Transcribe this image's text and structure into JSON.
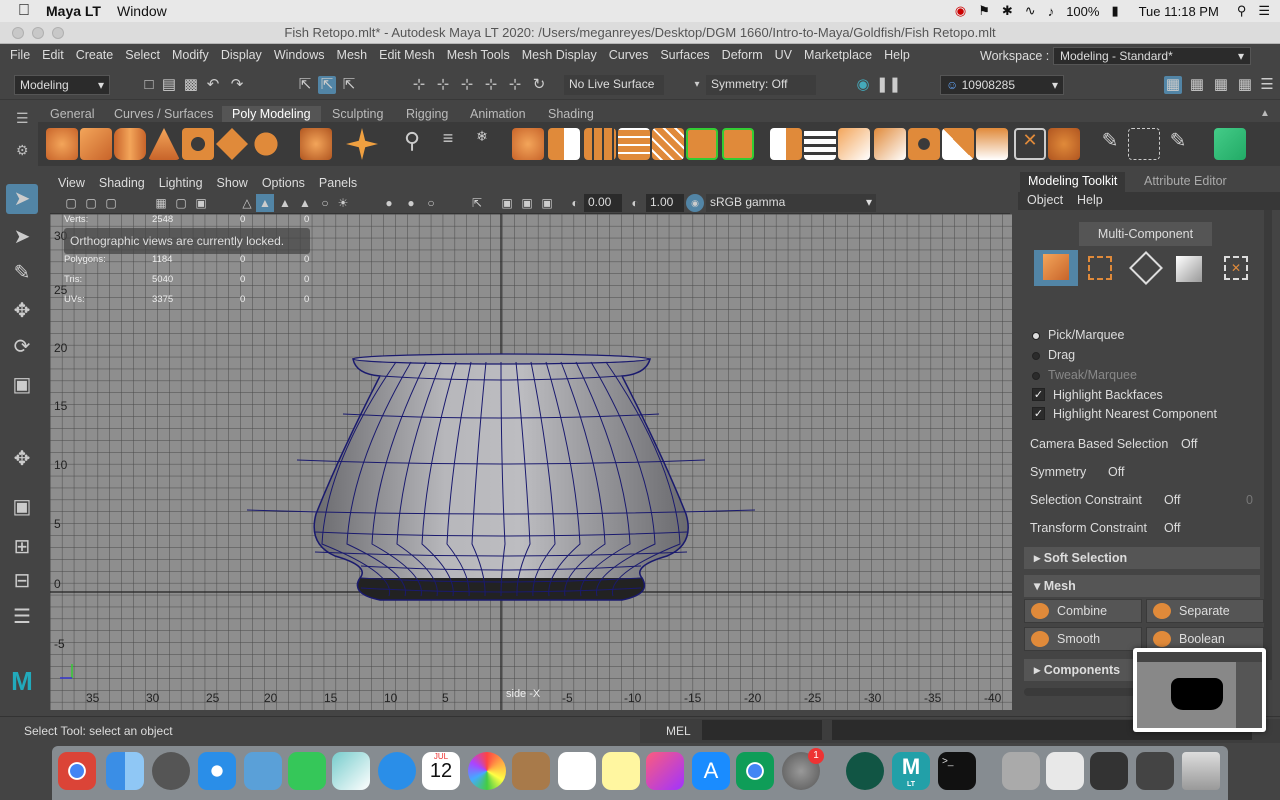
{
  "mac_menubar": {
    "app_name": "Maya LT",
    "menu_window": "Window",
    "battery": "100%",
    "clock": "Tue 11:18 PM"
  },
  "window": {
    "title": "Fish Retopo.mlt* - Autodesk Maya LT 2020: /Users/meganreyes/Desktop/DGM 1660/Intro-to-Maya/Goldfish/Fish Retopo.mlt"
  },
  "maya_menu": {
    "items": [
      "File",
      "Edit",
      "Create",
      "Select",
      "Modify",
      "Display",
      "Windows",
      "Mesh",
      "Edit Mesh",
      "Mesh Tools",
      "Mesh Display",
      "Curves",
      "Surfaces",
      "Deform",
      "UV",
      "Marketplace",
      "Help"
    ],
    "workspace_label": "Workspace :",
    "workspace_value": "Modeling - Standard*"
  },
  "status_line": {
    "menuset": "Modeling",
    "live_surface": "No Live Surface",
    "symmetry": "Symmetry: Off",
    "user_id": "10908285"
  },
  "shelf": {
    "tabs": [
      "General",
      "Curves / Surfaces",
      "Poly Modeling",
      "Sculpting",
      "Rigging",
      "Animation",
      "Shading"
    ],
    "active_tab": "Poly Modeling"
  },
  "viewport": {
    "menu": [
      "View",
      "Shading",
      "Lighting",
      "Show",
      "Options",
      "Panels"
    ],
    "exposure": "0.00",
    "gamma": "1.00",
    "colorspace": "sRGB gamma",
    "hud": {
      "rows": [
        {
          "label": "Verts:",
          "a": "2548",
          "b": "0",
          "c": "0"
        },
        {
          "label": "Polygons:",
          "a": "1184",
          "b": "0",
          "c": "0"
        },
        {
          "label": "Tris:",
          "a": "5040",
          "b": "0",
          "c": "0"
        },
        {
          "label": "UVs:",
          "a": "3375",
          "b": "0",
          "c": "0"
        }
      ]
    },
    "locked_msg": "Orthographic views are currently locked.",
    "y_ticks": [
      "30",
      "25",
      "20",
      "15",
      "10",
      "5",
      "0",
      "-5"
    ],
    "x_ticks": [
      "35",
      "30",
      "25",
      "20",
      "15",
      "10",
      "5",
      "-5",
      "-10",
      "-15",
      "-20",
      "-25",
      "-30",
      "-35",
      "-40"
    ],
    "camera_label": "side -X"
  },
  "right_panel": {
    "tabs": [
      "Modeling Toolkit",
      "Attribute Editor"
    ],
    "menu": [
      "Object",
      "Help"
    ],
    "multi_component": "Multi-Component",
    "pick_options": [
      "Pick/Marquee",
      "Drag",
      "Tweak/Marquee"
    ],
    "checks": [
      "Highlight Backfaces",
      "Highlight Nearest Component"
    ],
    "settings": [
      {
        "label": "Camera Based Selection",
        "value": "Off"
      },
      {
        "label": "Symmetry",
        "value": "Off"
      },
      {
        "label": "Selection Constraint",
        "value": "Off",
        "extra": "0"
      },
      {
        "label": "Transform Constraint",
        "value": "Off"
      }
    ],
    "sections": [
      "Soft Selection",
      "Mesh",
      "Components"
    ],
    "mesh_buttons": [
      "Combine",
      "Separate",
      "Smooth",
      "Boolean"
    ]
  },
  "help_line": {
    "message": "Select Tool: select an object",
    "mel": "MEL"
  },
  "dock": {
    "calendar_month": "JUL",
    "calendar_day": "12",
    "badge": "1",
    "maya_label": "LT"
  },
  "colors": {
    "wire": "#1a1a6e",
    "mesh": "#a9a9ad",
    "accent": "#5285a6"
  }
}
